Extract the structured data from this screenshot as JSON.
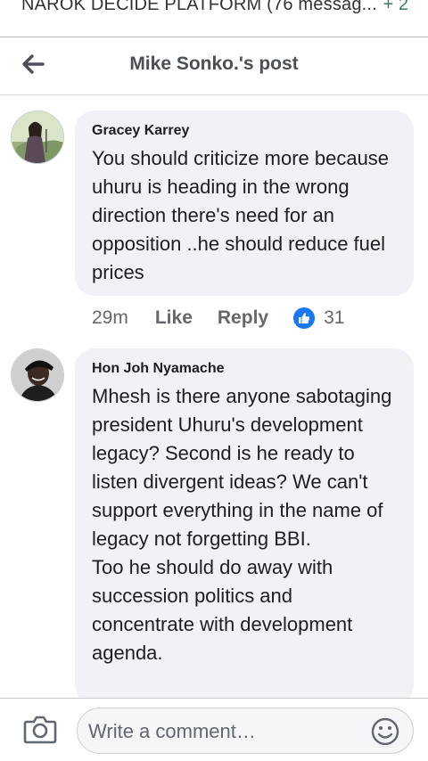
{
  "notification": {
    "text": "NAROK DECIDE PLATFORM (76 messag...",
    "count": "+ 2"
  },
  "header": {
    "title": "Mike Sonko.'s post",
    "back_icon": "arrow-left-icon"
  },
  "comments": [
    {
      "author": "Gracey Karrey",
      "text": "You should criticize more because uhuru is heading in the wrong direction there's need for an opposition ..he should reduce fuel prices",
      "time": "29m",
      "like_label": "Like",
      "reply_label": "Reply",
      "reactions": "31"
    },
    {
      "author": "Hon Joh Nyamache",
      "text": "Mhesh is there anyone sabotaging president Uhuru's development legacy? Second is he ready to listen divergent ideas? We can't support everything in the name of legacy not forgetting BBI.\nToo he should do away with succession politics and concentrate with development agenda."
    }
  ],
  "composer": {
    "placeholder": "Write a comment…",
    "camera_icon": "camera-icon",
    "emoji_icon": "smiley-icon"
  },
  "colors": {
    "accent": "#1877f2",
    "bubble": "#f0f2f5",
    "notification_count": "#2f7d5b"
  }
}
